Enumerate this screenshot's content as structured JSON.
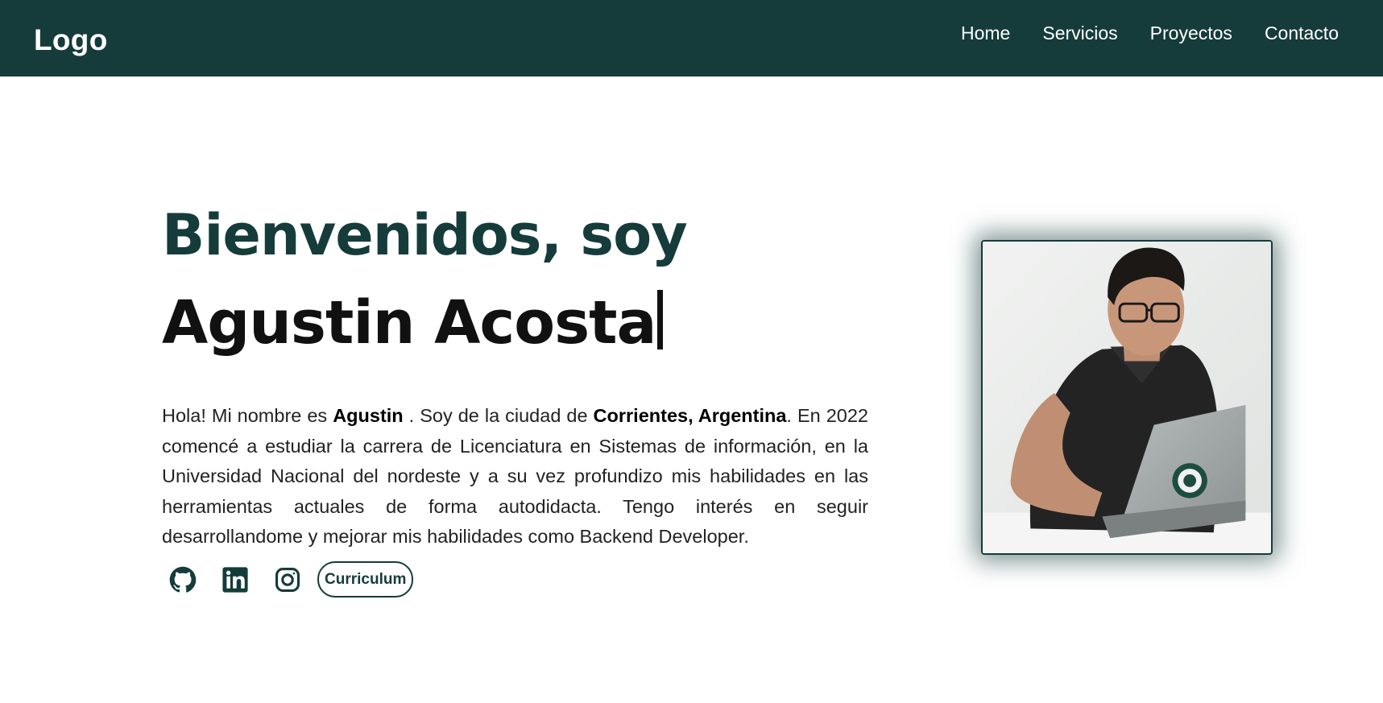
{
  "nav": {
    "logo": "Logo",
    "links": [
      "Home",
      "Servicios",
      "Proyectos",
      "Contacto"
    ]
  },
  "hero": {
    "greeting": "Bienvenidos, soy",
    "name": "Agustin Acosta",
    "bio": {
      "p1": "Hola! Mi nombre es ",
      "name_bold": "Agustin",
      "p2": " . Soy de la ciudad de ",
      "city_bold": "Corrientes, Argentina",
      "p3": ". En 2022 comencé a estudiar la carrera de Licenciatura en Sistemas de información, en la Universidad Nacional del nordeste y a su vez profundizo mis habilidades en las herramientas actuales de forma autodidacta. Tengo interés en seguir desarrollandome y mejorar mis habilidades como Backend Developer."
    },
    "social": {
      "icons": [
        "github-icon",
        "linkedin-icon",
        "instagram-icon"
      ],
      "cv_label": "Curriculum"
    }
  },
  "colors": {
    "primary": "#153c3a",
    "text": "#111111",
    "background": "#ffffff"
  }
}
